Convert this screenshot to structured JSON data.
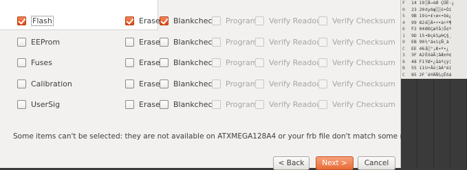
{
  "rows": [
    {
      "name": "Flash",
      "checked": true,
      "erase": true,
      "blankcheck": true
    },
    {
      "name": "EEProm",
      "checked": false,
      "erase": false,
      "blankcheck": false
    },
    {
      "name": "Fuses",
      "checked": false,
      "erase": false,
      "blankcheck": false
    },
    {
      "name": "Calibration",
      "checked": false,
      "erase": false,
      "blankcheck": false
    },
    {
      "name": "UserSig",
      "checked": false,
      "erase": false,
      "blankcheck": false
    }
  ],
  "labels": {
    "erase": "Erase",
    "blankcheck": "Blankcheck",
    "program": "Program",
    "verify_readout": "Verify Readout",
    "verify_checksum": "Verify Checksum"
  },
  "note": "Some items can't be selected: they are not available on ATXMEGA128A4 or your frb file don't match some memory areas",
  "buttons": {
    "back": "< Back",
    "next": "Next >",
    "cancel": "Cancel"
  },
  "hex_panel": {
    "lines": [
      [
        "F",
        "14 19",
        "░Ä→óØ ÇÜÉ·¿"
      ],
      [
        "0",
        "23 20",
        "ðyðφ░░õ•Òï"
      ],
      [
        "5",
        "9B 19",
        "ù•£↑ø×•ðè¿"
      ],
      [
        "4",
        "99 82",
        "ê░Ä•÷•à÷º¶"
      ],
      [
        "6",
        "F2 04",
        "ØßÇæÝå¦Õ¢º"
      ],
      [
        "1",
        "9D 15",
        "•ÐçêîµÞÇ§¸"
      ],
      [
        "0",
        "EB 90",
        "½°á±ìçÑ¸à"
      ],
      [
        "C",
        "EE 46",
        "å░°¡Æ¤º•¿"
      ],
      [
        "3",
        "3F A2",
        "ÉöáÃ¦âÆ±®¢"
      ],
      [
        "8",
        "48 F1",
        "ÝØ•¿åáºçý¦"
      ],
      [
        "B",
        "55 11",
        "U•Ãò¦âÁ°éï"
      ],
      [
        "C",
        "85 2F",
        "´é®ÄÑ¾çÊðá"
      ]
    ]
  }
}
